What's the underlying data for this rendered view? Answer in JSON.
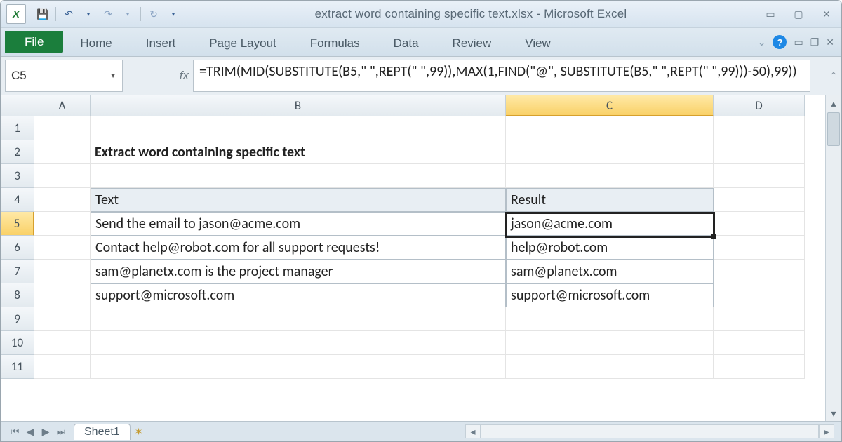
{
  "window": {
    "title": "extract word containing specific text.xlsx - Microsoft Excel"
  },
  "ribbon": {
    "file": "File",
    "tabs": [
      "Home",
      "Insert",
      "Page Layout",
      "Formulas",
      "Data",
      "Review",
      "View"
    ]
  },
  "namebox": "C5",
  "formula": "=TRIM(MID(SUBSTITUTE(B5,\" \",REPT(\" \",99)),MAX(1,FIND(\"@\", SUBSTITUTE(B5,\" \",REPT(\" \",99)))-50),99))",
  "columns": [
    "A",
    "B",
    "C",
    "D"
  ],
  "row_labels": [
    "1",
    "2",
    "3",
    "4",
    "5",
    "6",
    "7",
    "8",
    "9",
    "10",
    "11"
  ],
  "active": {
    "col": "C",
    "row": "5"
  },
  "content": {
    "heading": "Extract word containing specific text",
    "headers": {
      "text": "Text",
      "result": "Result"
    },
    "rows": [
      {
        "text": "Send the email to jason@acme.com",
        "result": "jason@acme.com"
      },
      {
        "text": "Contact help@robot.com for all support requests!",
        "result": "help@robot.com"
      },
      {
        "text": "sam@planetx.com is the project manager",
        "result": "sam@planetx.com"
      },
      {
        "text": "support@microsoft.com",
        "result": "support@microsoft.com"
      }
    ]
  },
  "sheet_tab": "Sheet1"
}
